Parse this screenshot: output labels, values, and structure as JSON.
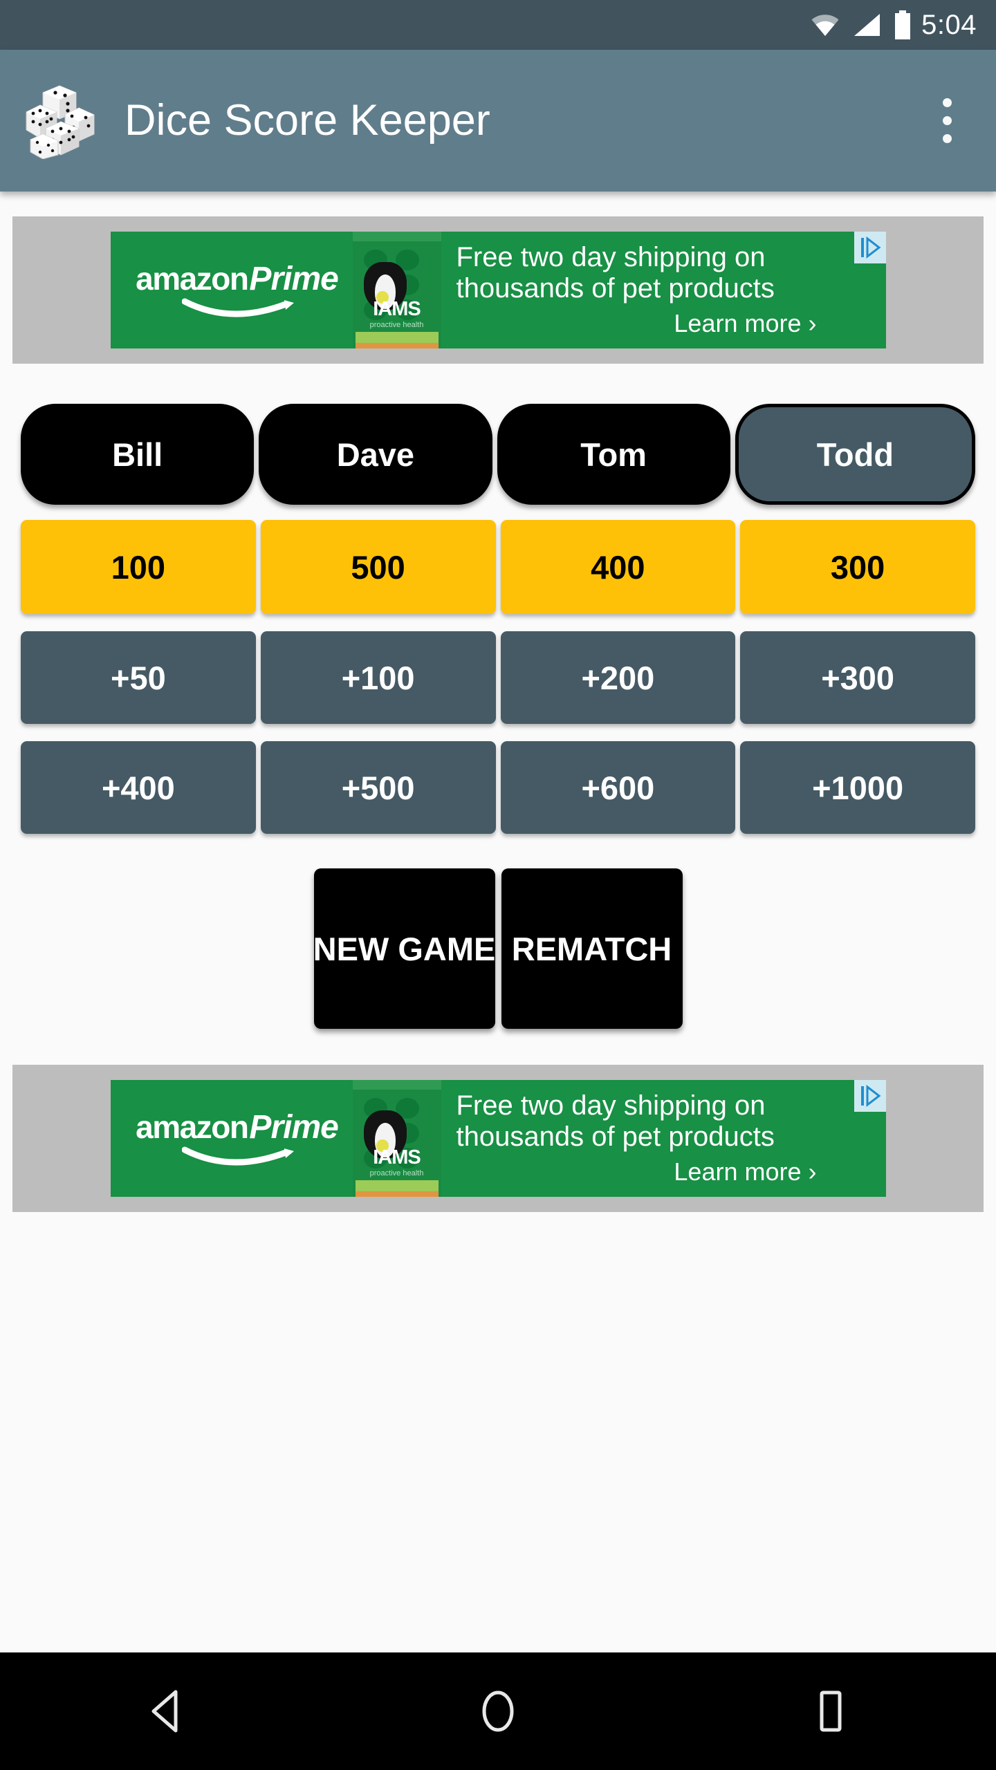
{
  "status_bar": {
    "time": "5:04",
    "icons": [
      "wifi-icon",
      "signal-icon",
      "battery-icon"
    ]
  },
  "app_bar": {
    "logo_icon": "dice-cluster-icon",
    "title": "Dice Score Keeper",
    "overflow_icon": "overflow-menu-icon"
  },
  "ad_banner": {
    "brand_amazon": "amazon",
    "brand_prime": "Prime",
    "product_name": "IAMS",
    "product_sub": "proactive health",
    "headline_line1": "Free two day shipping on",
    "headline_line2": "thousands of pet products",
    "cta": "Learn more ›",
    "adchoices_icon": "adchoices-icon"
  },
  "game": {
    "players": [
      {
        "name": "Bill",
        "selected": false
      },
      {
        "name": "Dave",
        "selected": false
      },
      {
        "name": "Tom",
        "selected": false
      },
      {
        "name": "Todd",
        "selected": true
      }
    ],
    "scores": [
      "100",
      "500",
      "400",
      "300"
    ],
    "increments_row1": [
      "+50",
      "+100",
      "+200",
      "+300"
    ],
    "increments_row2": [
      "+400",
      "+500",
      "+600",
      "+1000"
    ],
    "actions": [
      "NEW GAME",
      "REMATCH"
    ]
  },
  "nav_bar": {
    "back_icon": "back-triangle-icon",
    "home_icon": "home-circle-icon",
    "recents_icon": "recents-square-icon"
  },
  "colors": {
    "status_bar": "#41545E",
    "app_bar": "#607D8B",
    "page_background": "#FAFAFA",
    "ad_container": "#BDBDBD",
    "ad_green": "#189045",
    "score_amber": "#FFC107",
    "increment_slate": "#455A64",
    "button_black": "#000000",
    "nav_bar": "#000000"
  }
}
